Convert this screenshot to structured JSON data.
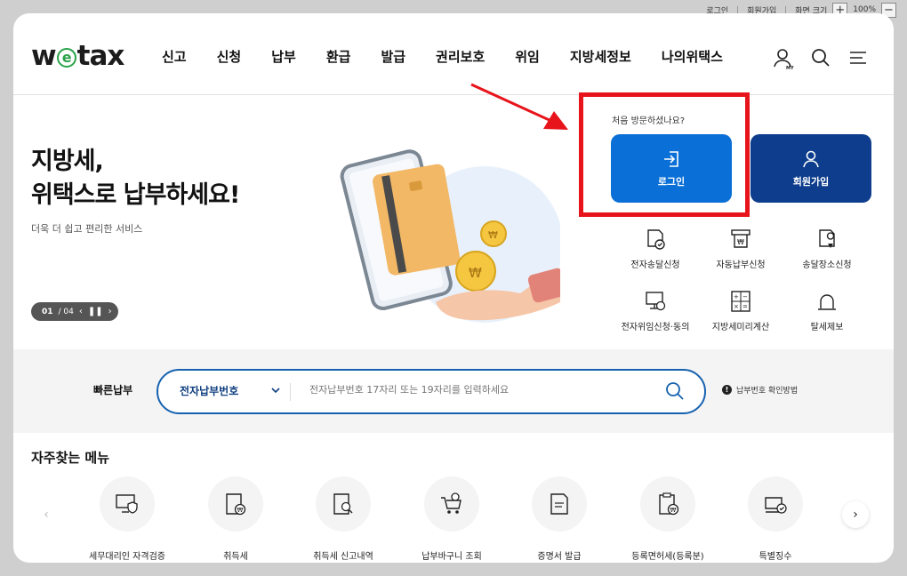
{
  "utility": {
    "login": "로그인",
    "join": "회원가입",
    "zoom_label": "화면 크기",
    "zoom_value": "100%",
    "zoom_in": "+",
    "zoom_out": "−"
  },
  "brand": {
    "logo_pre": "w",
    "logo_e": "e",
    "logo_post": "tax"
  },
  "nav": [
    "신고",
    "신청",
    "납부",
    "환급",
    "발급",
    "권리보호",
    "위임",
    "지방세정보",
    "나의위택스"
  ],
  "header_icons": [
    "my-page-icon",
    "search-icon",
    "menu-icon"
  ],
  "hero": {
    "title_line1": "지방세,",
    "title_line2": "위택스로 납부하세요!",
    "subtitle": "더욱 더 쉽고 편리한 서비스",
    "page_current": "01",
    "page_total": "/ 04"
  },
  "login_area": {
    "question": "처음 방문하셨나요?",
    "login_label": "로그인",
    "join_label": "회원가입"
  },
  "services": [
    {
      "label": "전자송달신청",
      "icon": "envelope-check-icon"
    },
    {
      "label": "자동납부신청",
      "icon": "auto-pay-icon"
    },
    {
      "label": "송달장소신청",
      "icon": "location-envelope-icon"
    },
    {
      "label": "전자위임신청·동의",
      "icon": "monitor-delegate-icon"
    },
    {
      "label": "지방세미리계산",
      "icon": "calculator-icon"
    },
    {
      "label": "탈세제보",
      "icon": "siren-icon"
    }
  ],
  "quickpay": {
    "label": "빠른납부",
    "select_value": "전자납부번호",
    "placeholder": "전자납부번호 17자리 또는 19자리를 입력하세요",
    "howto": "납부번호 확인방법"
  },
  "frequent": {
    "title": "자주찾는 메뉴",
    "items": [
      {
        "label": "세무대리인 자격검증",
        "icon": "monitor-shield-icon"
      },
      {
        "label": "취득세",
        "icon": "document-won-icon"
      },
      {
        "label": "취득세 신고내역",
        "icon": "document-search-icon"
      },
      {
        "label": "납부바구니 조회",
        "icon": "cart-search-icon"
      },
      {
        "label": "증명서 발급",
        "icon": "certificate-icon"
      },
      {
        "label": "등록면허세(등록분)",
        "icon": "clipboard-won-icon"
      },
      {
        "label": "특별징수",
        "icon": "box-check-icon"
      }
    ]
  },
  "colors": {
    "primary": "#0a6fd6",
    "navy": "#0d3d8c",
    "highlight": "#e8141b",
    "logo_green": "#2aa34a"
  }
}
